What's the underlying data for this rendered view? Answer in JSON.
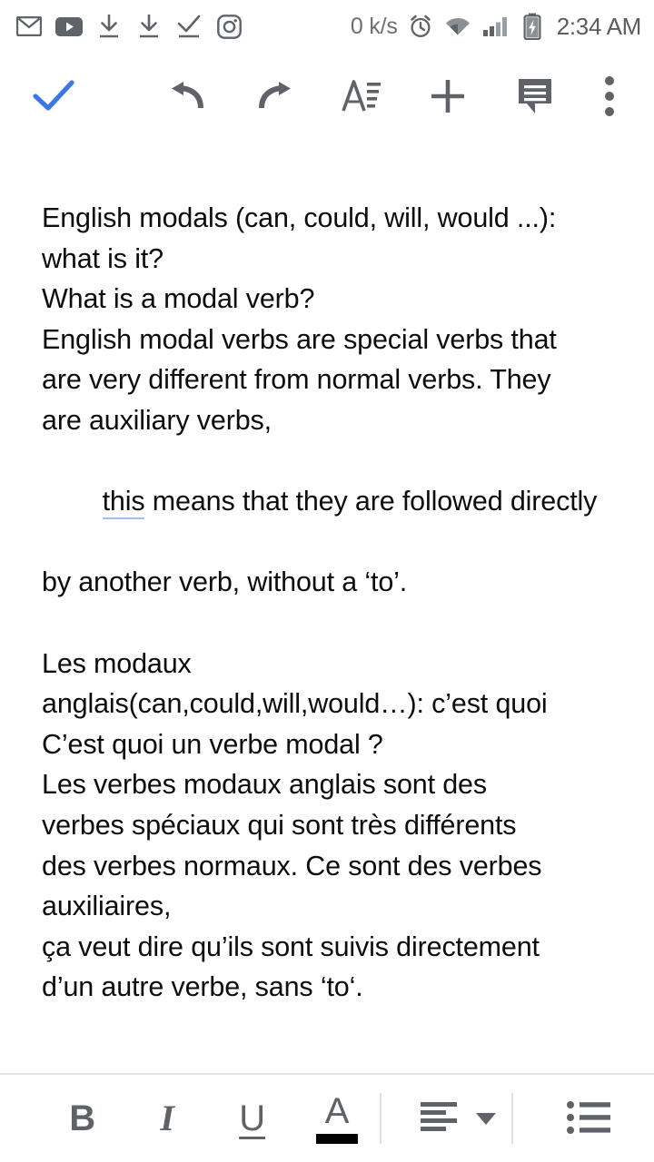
{
  "status_bar": {
    "notification_icons": [
      {
        "name": "gmail-icon",
        "label": "Gmail"
      },
      {
        "name": "youtube-icon",
        "label": "YouTube"
      },
      {
        "name": "download-icon",
        "label": "Download"
      },
      {
        "name": "download-icon-2",
        "label": "Download"
      },
      {
        "name": "download-complete-icon",
        "label": "Download complete"
      },
      {
        "name": "instagram-icon",
        "label": "Instagram"
      }
    ],
    "network_speed": "0 k/s",
    "alarm_icon": "alarm-clock-icon",
    "wifi_icon": "wifi-icon",
    "signal_icon": "cellular-signal-icon",
    "battery_icon": "battery-charging-icon",
    "time": "2:34 AM"
  },
  "top_toolbar": {
    "done_label": "done-checkmark",
    "undo_label": "undo",
    "redo_label": "redo",
    "format_label": "text-format",
    "insert_label": "insert",
    "comment_label": "comment",
    "more_label": "more-options",
    "accent_color": "#3b78e7",
    "icon_color": "#5f6368"
  },
  "document": {
    "lines": [
      {
        "text": "English modals (can, could, will, would ...):",
        "blank": false
      },
      {
        "text": "what is it?",
        "blank": false
      },
      {
        "text": "What is a modal verb?",
        "blank": false
      },
      {
        "text": "English modal verbs are special verbs that",
        "blank": false
      },
      {
        "text": "are very different from normal verbs. They",
        "blank": false
      },
      {
        "text": "are auxiliary verbs,",
        "blank": false
      },
      {
        "text": "this means that they are followed directly",
        "blank": false,
        "grammar_word": "this"
      },
      {
        "text": "by another verb, without a ‘to’.",
        "blank": false
      },
      {
        "text": "",
        "blank": true
      },
      {
        "text": "Les modaux",
        "blank": false
      },
      {
        "text": "anglais(can,could,will,would…): c’est quoi",
        "blank": false
      },
      {
        "text": "C’est quoi un verbe modal ?",
        "blank": false
      },
      {
        "text": "Les verbes modaux anglais sont des",
        "blank": false
      },
      {
        "text": "verbes spéciaux qui sont très différents",
        "blank": false
      },
      {
        "text": "des verbes normaux. Ce sont des verbes",
        "blank": false
      },
      {
        "text": "auxiliaires,",
        "blank": false
      },
      {
        "text": "ça veut dire qu’ils sont suivis directement",
        "blank": false
      },
      {
        "text": "d’un autre verbe, sans ‘to‘.",
        "blank": false
      }
    ],
    "grammar_underline_color": "#a3bdf0",
    "text_color": "#0d0d0d"
  },
  "bottom_toolbar": {
    "bold_label": "B",
    "italic_label": "I",
    "underline_label": "U",
    "text_color_label": "A",
    "text_color_swatch": "#000000",
    "align_label": "align-left",
    "list_label": "bulleted-list",
    "icon_color": "#5f6368"
  }
}
